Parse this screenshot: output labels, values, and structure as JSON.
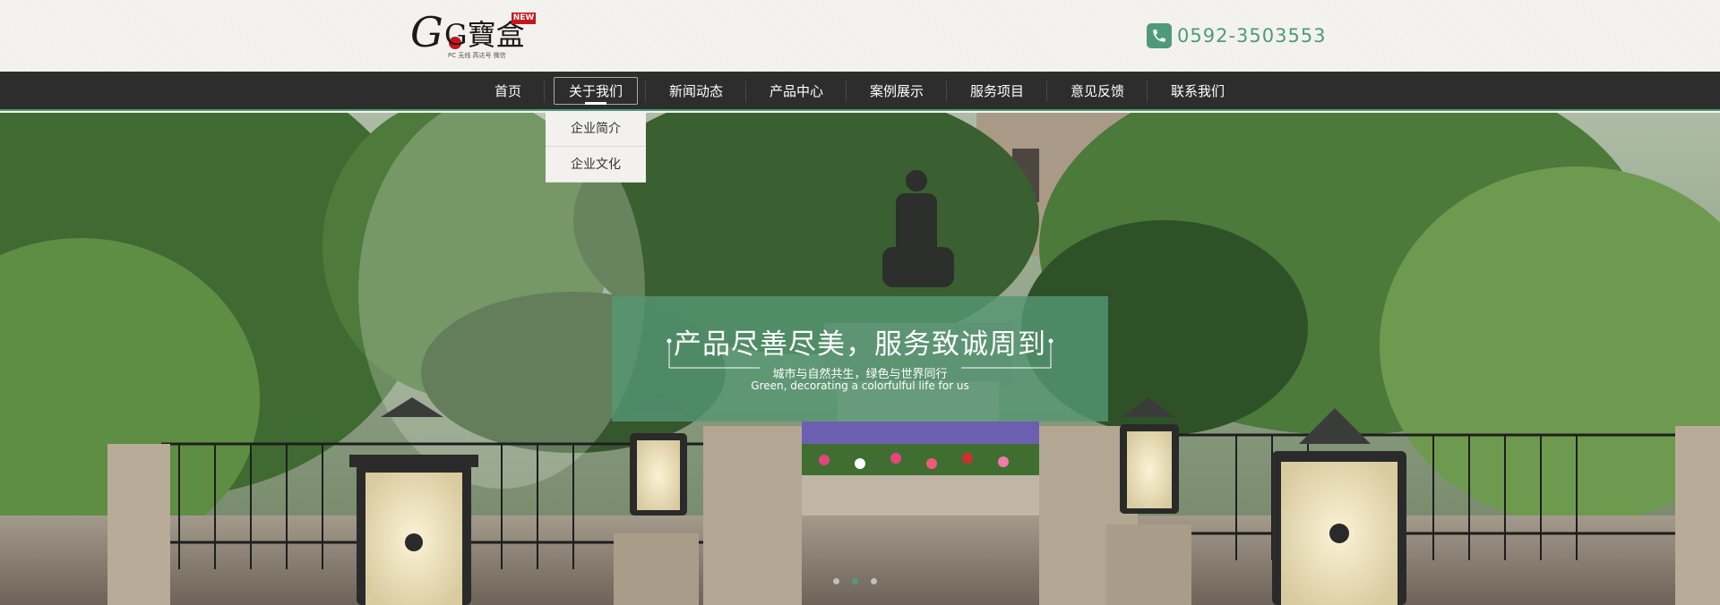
{
  "header": {
    "logo_text": "G寶盒",
    "logo_badge": "NEW",
    "logo_subtitle": "PC 无线 高达号 微信",
    "phone_icon": "phone-icon",
    "phone": "0592-3503553"
  },
  "nav": {
    "items": [
      {
        "label": "首页"
      },
      {
        "label": "关于我们",
        "active": true
      },
      {
        "label": "新闻动态"
      },
      {
        "label": "产品中心"
      },
      {
        "label": "案例展示"
      },
      {
        "label": "服务项目"
      },
      {
        "label": "意见反馈"
      },
      {
        "label": "联系我们"
      }
    ],
    "dropdown": [
      {
        "label": "企业简介"
      },
      {
        "label": "企业文化"
      }
    ]
  },
  "banner": {
    "title": "产品尽善尽美，服务致诚周到",
    "subtitle": "城市与自然共生，绿色与世界同行",
    "english": "Green, decorating a colorfulful life for us",
    "slides": 3,
    "active_slide": 2
  },
  "colors": {
    "accent": "#4f9a78",
    "nav_bg": "#2d2d2d",
    "badge": "#c8161d"
  }
}
